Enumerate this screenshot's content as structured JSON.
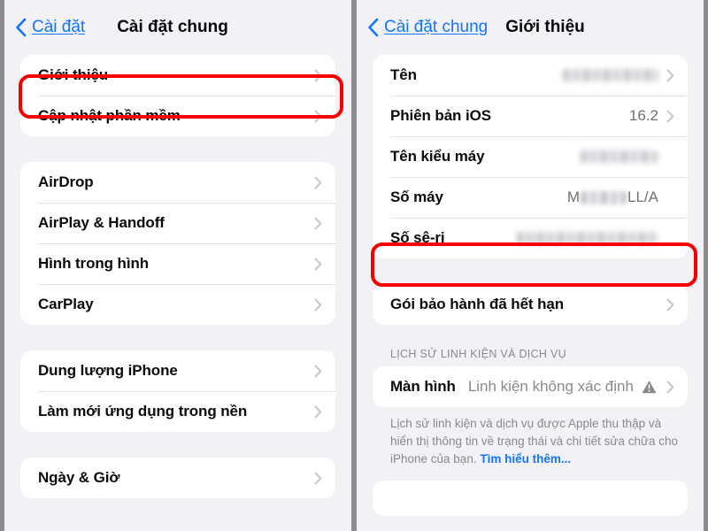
{
  "theme": {
    "accent_blue": "#1275ff",
    "highlight_red": "#f40000",
    "background": "#f1f1f6",
    "card": "#ffffff",
    "secondary_text": "#8a8a8e"
  },
  "left_screen": {
    "nav": {
      "back_label": "Cài đặt",
      "title": "Cài đặt chung",
      "back_icon": "chevron-left-icon"
    },
    "groups": [
      {
        "rows": [
          {
            "label": "Giới thiệu",
            "accessory": "chevron-right-icon",
            "highlighted": true
          },
          {
            "label": "Cập nhật phần mềm",
            "accessory": "chevron-right-icon"
          }
        ]
      },
      {
        "rows": [
          {
            "label": "AirDrop",
            "accessory": "chevron-right-icon"
          },
          {
            "label": "AirPlay & Handoff",
            "accessory": "chevron-right-icon"
          },
          {
            "label": "Hình trong hình",
            "accessory": "chevron-right-icon"
          },
          {
            "label": "CarPlay",
            "accessory": "chevron-right-icon"
          }
        ]
      },
      {
        "rows": [
          {
            "label": "Dung lượng iPhone",
            "accessory": "chevron-right-icon"
          },
          {
            "label": "Làm mới ứng dụng trong nền",
            "accessory": "chevron-right-icon"
          }
        ]
      },
      {
        "rows": [
          {
            "label": "Ngày & Giờ",
            "accessory": "chevron-right-icon"
          }
        ]
      }
    ]
  },
  "right_screen": {
    "nav": {
      "back_label": "Cài đặt chung",
      "title": "Giới thiệu",
      "back_icon": "chevron-left-icon"
    },
    "info_rows": [
      {
        "label": "Tên",
        "value": "",
        "redacted": true,
        "accessory": "chevron-right-icon"
      },
      {
        "label": "Phiên bản iOS",
        "value": "16.2",
        "redacted": false,
        "accessory": "chevron-right-icon"
      },
      {
        "label": "Tên kiểu máy",
        "value": "",
        "redacted": true,
        "accessory": "none"
      },
      {
        "label": "Số máy",
        "value_prefix": "M",
        "value_suffix": "LL/A",
        "redacted": true,
        "accessory": "none"
      },
      {
        "label": "Số sê-ri",
        "value": "",
        "redacted": true,
        "accessory": "none",
        "highlighted": true
      }
    ],
    "warranty_row": {
      "label": "Gói bảo hành đã hết hạn",
      "accessory": "chevron-right-icon"
    },
    "parts_section": {
      "header": "Lịch sử linh kiện và dịch vụ",
      "rows": [
        {
          "label": "Màn hình",
          "value": "Linh kiện không xác định",
          "badge_icon": "warning-triangle-icon",
          "accessory": "chevron-right-icon"
        }
      ],
      "footer_text": "Lịch sử linh kiện và dịch vụ được Apple thu thập và hiển thị thông tin về trạng thái và chi tiết sửa chữa cho iPhone của bạn. ",
      "footer_link": "Tìm hiểu thêm..."
    }
  }
}
